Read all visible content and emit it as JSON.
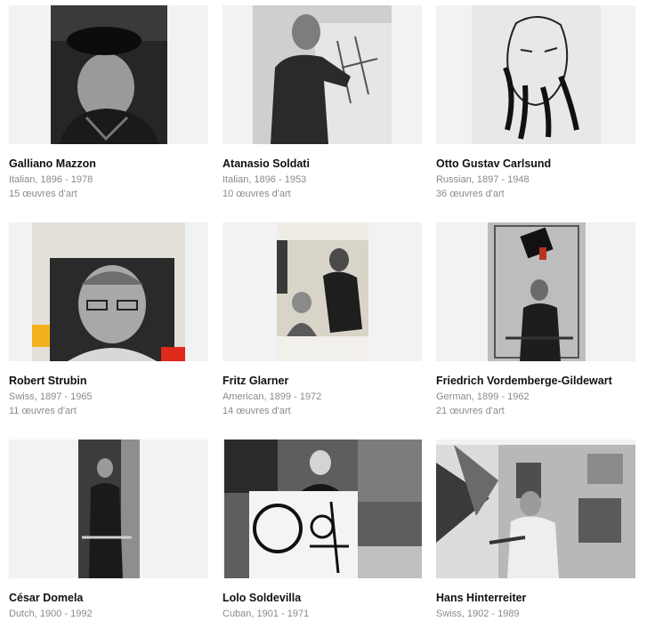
{
  "artists": [
    {
      "name": "Galliano Mazzon",
      "meta": "Italian, 1896 - 1978",
      "count": "15 œuvres d'art"
    },
    {
      "name": "Atanasio Soldati",
      "meta": "Italian, 1896 - 1953",
      "count": "10 œuvres d'art"
    },
    {
      "name": "Otto Gustav Carlsund",
      "meta": "Russian, 1897 - 1948",
      "count": "36 œuvres d'art"
    },
    {
      "name": "Robert Strubin",
      "meta": "Swiss, 1897 - 1965",
      "count": "11 œuvres d'art"
    },
    {
      "name": "Fritz Glarner",
      "meta": "American, 1899 - 1972",
      "count": "14 œuvres d'art"
    },
    {
      "name": "Friedrich Vordemberge-Gildewart",
      "meta": "German, 1899 - 1962",
      "count": "21 œuvres d'art"
    },
    {
      "name": "César Domela",
      "meta": "Dutch, 1900 - 1992",
      "count": ""
    },
    {
      "name": "Lolo Soldevilla",
      "meta": "Cuban, 1901 - 1971",
      "count": ""
    },
    {
      "name": "Hans Hinterreiter",
      "meta": "Swiss, 1902 - 1989",
      "count": ""
    }
  ]
}
